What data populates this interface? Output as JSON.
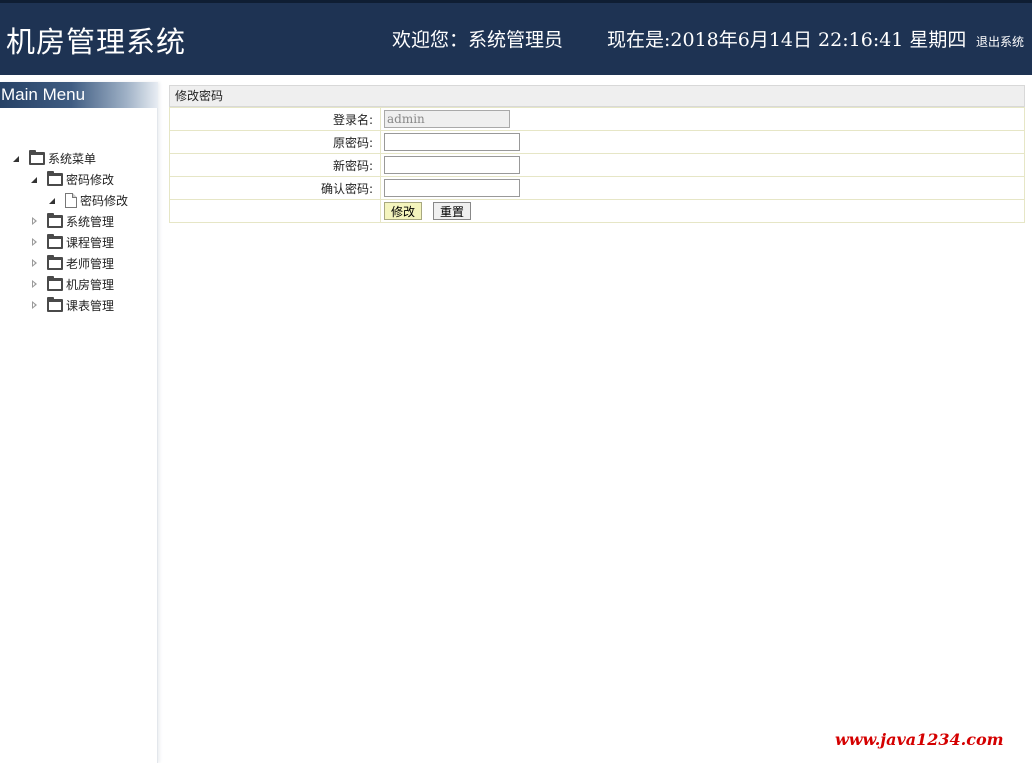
{
  "header": {
    "app_title": "机房管理系统",
    "welcome_text": "欢迎您：系统管理员",
    "clock_text": "现在是:2018年6月14日 22:16:41 星期四",
    "logout_label": "退出系统",
    "background_color": "#1e3353"
  },
  "sidebar": {
    "title": "Main Menu",
    "tree": [
      {
        "label": "系统菜单",
        "icon": "folder-icon",
        "expanded": true,
        "level": 0
      },
      {
        "label": "密码修改",
        "icon": "folder-icon",
        "expanded": true,
        "level": 1
      },
      {
        "label": "密码修改",
        "icon": "file-icon",
        "expanded": true,
        "level": 2
      },
      {
        "label": "系统管理",
        "icon": "folder-icon",
        "expanded": false,
        "level": 1
      },
      {
        "label": "课程管理",
        "icon": "folder-icon",
        "expanded": false,
        "level": 1
      },
      {
        "label": "老师管理",
        "icon": "folder-icon",
        "expanded": false,
        "level": 1
      },
      {
        "label": "机房管理",
        "icon": "folder-icon",
        "expanded": false,
        "level": 1
      },
      {
        "label": "课表管理",
        "icon": "folder-icon",
        "expanded": false,
        "level": 1
      }
    ]
  },
  "form": {
    "title": "修改密码",
    "fields": [
      {
        "label": "登录名:",
        "value": "admin",
        "disabled": true
      },
      {
        "label": "原密码:",
        "value": "",
        "disabled": false
      },
      {
        "label": "新密码:",
        "value": "",
        "disabled": false
      },
      {
        "label": "确认密码:",
        "value": "",
        "disabled": false
      }
    ],
    "submit_label": "修改",
    "reset_label": "重置"
  },
  "watermark": "www.java1234.com"
}
